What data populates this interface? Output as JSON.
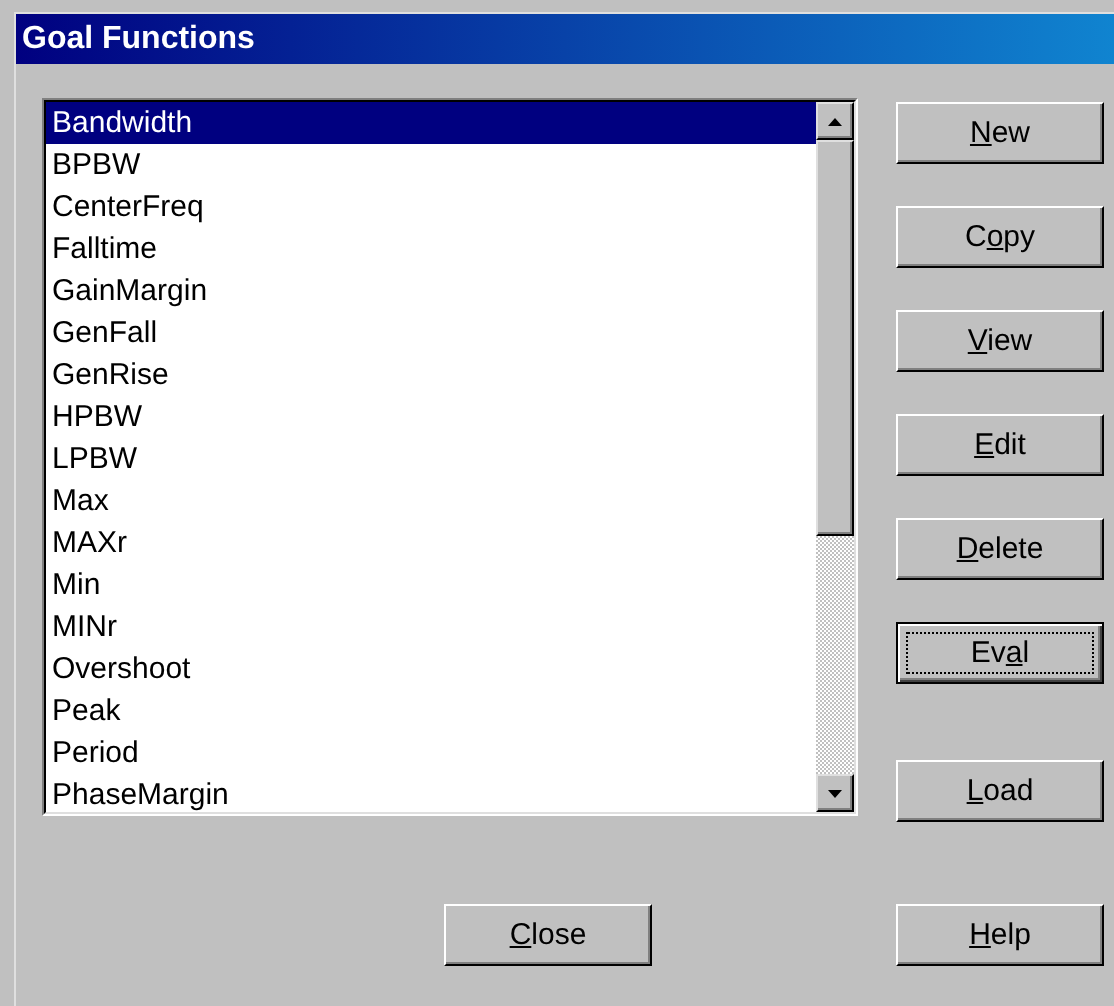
{
  "window": {
    "title": "Goal Functions"
  },
  "list": {
    "items": [
      {
        "label": "Bandwidth",
        "selected": true
      },
      {
        "label": "BPBW",
        "selected": false
      },
      {
        "label": "CenterFreq",
        "selected": false
      },
      {
        "label": "Falltime",
        "selected": false
      },
      {
        "label": "GainMargin",
        "selected": false
      },
      {
        "label": "GenFall",
        "selected": false
      },
      {
        "label": "GenRise",
        "selected": false
      },
      {
        "label": "HPBW",
        "selected": false
      },
      {
        "label": "LPBW",
        "selected": false
      },
      {
        "label": "Max",
        "selected": false
      },
      {
        "label": "MAXr",
        "selected": false
      },
      {
        "label": "Min",
        "selected": false
      },
      {
        "label": "MINr",
        "selected": false
      },
      {
        "label": "Overshoot",
        "selected": false
      },
      {
        "label": "Peak",
        "selected": false
      },
      {
        "label": "Period",
        "selected": false
      },
      {
        "label": "PhaseMargin",
        "selected": false
      }
    ]
  },
  "side_buttons": [
    {
      "key": "N",
      "post": "ew",
      "focused": false
    },
    {
      "pre": "C",
      "key": "o",
      "post": "py",
      "focused": false
    },
    {
      "key": "V",
      "post": "iew",
      "focused": false
    },
    {
      "key": "E",
      "post": "dit",
      "focused": false
    },
    {
      "key": "D",
      "post": "elete",
      "focused": false
    },
    {
      "pre": "Ev",
      "key": "a",
      "post": "l",
      "focused": true
    }
  ],
  "load_button": {
    "key": "L",
    "post": "oad",
    "focused": false
  },
  "bottom_buttons": [
    {
      "key": "C",
      "post": "lose",
      "focused": false
    },
    {
      "key": "H",
      "post": "elp",
      "focused": false
    }
  ]
}
